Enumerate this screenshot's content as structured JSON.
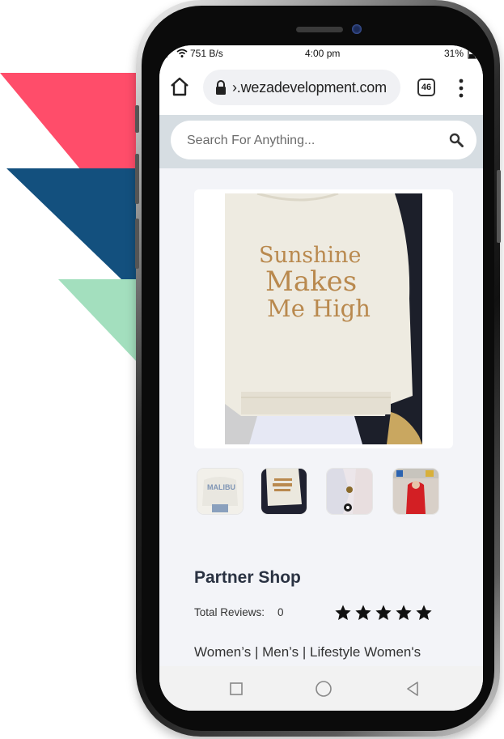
{
  "colors": {
    "deco_pink": "#ff4d6a",
    "deco_navy": "#13507e",
    "deco_mint": "#a3dfbe",
    "title_text": "#2a3242",
    "search_band": "#d6dde2",
    "page_bg": "#f3f4f8"
  },
  "status_bar": {
    "speed": "751 B/s",
    "time": "4:00 pm",
    "battery": "31%",
    "icons": [
      "signal-icon",
      "wifi-icon",
      "battery-icon"
    ]
  },
  "browser": {
    "url": "›.wezadevelopment.com",
    "tab_count": "46",
    "icons": [
      "home-icon",
      "lock-icon",
      "tabs-icon",
      "more-vert-icon"
    ]
  },
  "search": {
    "placeholder": "Search For Anything...",
    "icon": "search-icon"
  },
  "product": {
    "main_image_text": [
      "Sunshine",
      "Makes",
      "Me High"
    ],
    "thumbnail_count": 4,
    "thumbnail_1_text": "MALIBU",
    "shop_name": "Partner Shop",
    "reviews_label": "Total Reviews:",
    "reviews_count": "0",
    "rating_stars": 5,
    "categories": "Women’s | Men’s | Lifestyle Women's"
  },
  "nav_bar": {
    "icons": [
      "recent-apps-icon",
      "home-circle-icon",
      "back-icon"
    ]
  }
}
